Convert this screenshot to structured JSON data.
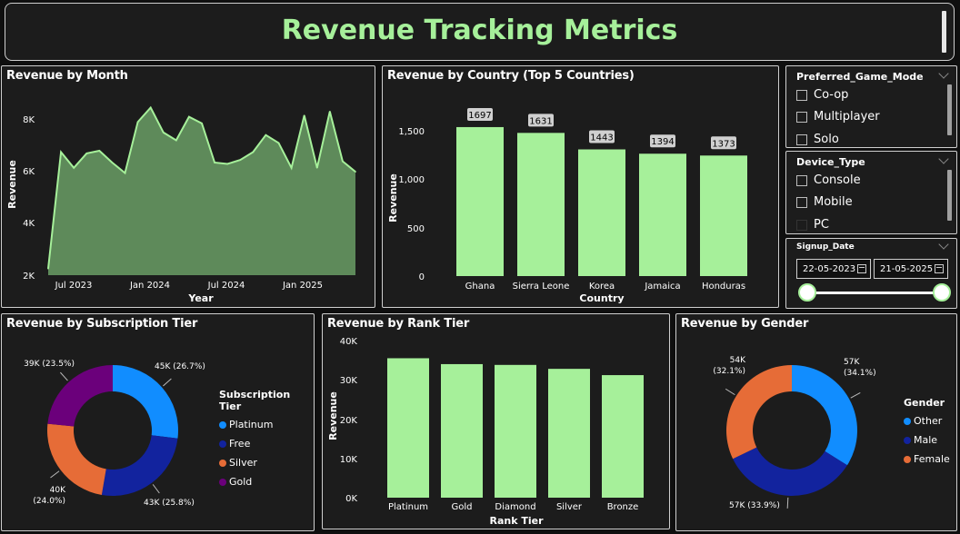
{
  "header": {
    "title": "Revenue Tracking Metrics"
  },
  "colors": {
    "accent": "#a6f09a",
    "area": "#5e8a5a",
    "blue": "#118dff",
    "navy": "#12239e",
    "orange": "#e66c37",
    "purple": "#6b007b"
  },
  "month_chart": {
    "title": "Revenue by Month",
    "xlabel": "Year",
    "ylabel": "Revenue",
    "yticks": [
      "8K",
      "6K",
      "4K",
      "2K"
    ],
    "xticks": [
      "Jul 2023",
      "Jan 2024",
      "Jul 2024",
      "Jan 2025"
    ]
  },
  "country_chart": {
    "title": "Revenue by Country (Top 5 Countries)",
    "xlabel": "Country",
    "ylabel": "Revenue",
    "yticks": [
      "1,500",
      "1,000",
      "500",
      "0"
    ]
  },
  "rank_chart": {
    "title": "Revenue by Rank Tier",
    "xlabel": "Rank Tier",
    "ylabel": "Revenue",
    "yticks": [
      "40K",
      "30K",
      "20K",
      "10K",
      "0K"
    ]
  },
  "sub_chart": {
    "title": "Revenue by Subscription Tier",
    "legend_title": "Subscription Tier"
  },
  "gender_chart": {
    "title": "Revenue by Gender",
    "legend_title": "Gender"
  },
  "slicers": {
    "game_mode": {
      "title": "Preferred_Game_Mode",
      "options": [
        "Co-op",
        "Multiplayer",
        "Solo"
      ]
    },
    "device": {
      "title": "Device_Type",
      "options": [
        "Console",
        "Mobile",
        "PC"
      ]
    },
    "signup": {
      "title": "Signup_Date",
      "start": "22-05-2023",
      "end": "21-05-2025"
    }
  },
  "chart_data": [
    {
      "type": "area",
      "title": "Revenue by Month",
      "xlabel": "Year",
      "ylabel": "Revenue",
      "x": [
        "2023-05",
        "2023-06",
        "2023-07",
        "2023-08",
        "2023-09",
        "2023-10",
        "2023-11",
        "2023-12",
        "2024-01",
        "2024-02",
        "2024-03",
        "2024-04",
        "2024-05",
        "2024-06",
        "2024-07",
        "2024-08",
        "2024-09",
        "2024-10",
        "2024-11",
        "2024-12",
        "2025-01",
        "2025-02",
        "2025-03",
        "2025-04",
        "2025-05"
      ],
      "values": [
        2250,
        6700,
        6100,
        6650,
        6750,
        6300,
        5900,
        7850,
        8400,
        7450,
        7150,
        8050,
        7800,
        6300,
        6250,
        6400,
        6700,
        7350,
        7050,
        6100,
        8100,
        6100,
        8250,
        6350,
        5950
      ],
      "ylim": [
        2000,
        9000
      ]
    },
    {
      "type": "bar",
      "title": "Revenue by Country (Top 5 Countries)",
      "xlabel": "Country",
      "ylabel": "Revenue",
      "categories": [
        "Ghana",
        "Sierra Leone",
        "Korea",
        "Jamaica",
        "Honduras"
      ],
      "values": [
        1697,
        1631,
        1443,
        1394,
        1373
      ],
      "ylim": [
        0,
        1800
      ]
    },
    {
      "type": "pie",
      "title": "Revenue by Subscription Tier",
      "categories": [
        "Platinum",
        "Free",
        "Silver",
        "Gold"
      ],
      "values": [
        45000,
        43000,
        40000,
        39000
      ],
      "labels": [
        "45K (26.7%)",
        "43K (25.8%)",
        "40K\n(24.0%)",
        "39K (23.5%)"
      ]
    },
    {
      "type": "bar",
      "title": "Revenue by Rank Tier",
      "xlabel": "Rank Tier",
      "ylabel": "Revenue",
      "categories": [
        "Platinum",
        "Gold",
        "Diamond",
        "Silver",
        "Bronze"
      ],
      "values": [
        35500,
        34000,
        33800,
        32800,
        31200
      ],
      "ylim": [
        0,
        40000
      ]
    },
    {
      "type": "pie",
      "title": "Revenue by Gender",
      "categories": [
        "Other",
        "Male",
        "Female"
      ],
      "values": [
        57000,
        57000,
        54000
      ],
      "labels": [
        "57K\n(34.1%)",
        "57K (33.9%)",
        "54K\n(32.1%)"
      ]
    }
  ]
}
